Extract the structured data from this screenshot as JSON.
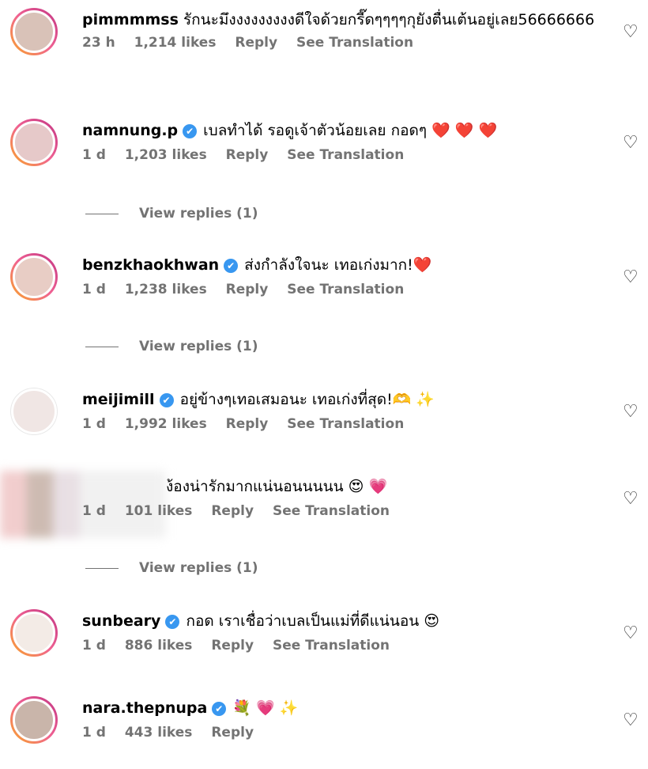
{
  "comments": [
    {
      "username": "pimmmmss",
      "verified": false,
      "text": "รักนะมึงงงงงงงงงดีใจด้วยกรี๊ดๆๆๆๆกุยังตื่นเต้นอยู่เลย56666666",
      "time": "23 h",
      "likes": "1,214 likes",
      "reply": "Reply",
      "translate": "See Translation",
      "view_replies": ""
    },
    {
      "username": "namnung.p",
      "verified": true,
      "text": "เบลทำได้ รอดูเจ้าตัวน้อยเลย กอดๆ ❤️ ❤️ ❤️",
      "time": "1 d",
      "likes": "1,203 likes",
      "reply": "Reply",
      "translate": "See Translation",
      "view_replies": "View replies (1)"
    },
    {
      "username": "benzkhaokhwan",
      "verified": true,
      "text": "ส่งกำลังใจนะ เทอเก่งมาก!❤️",
      "time": "1 d",
      "likes": "1,238 likes",
      "reply": "Reply",
      "translate": "See Translation",
      "view_replies": "View replies (1)"
    },
    {
      "username": "meijimill",
      "verified": true,
      "text": "อยู่ข้างๆเทอเสมอนะ เทอเก่งที่สุด!🫶 ✨",
      "time": "1 d",
      "likes": "1,992 likes",
      "reply": "Reply",
      "translate": "See Translation",
      "view_replies": ""
    },
    {
      "username": "",
      "verified": false,
      "text": "ง้องน่ารักมากแน่นอนนนนน 😍 💗",
      "time": "1 d",
      "likes": "101 likes",
      "reply": "Reply",
      "translate": "See Translation",
      "view_replies": "View replies (1)"
    },
    {
      "username": "sunbeary",
      "verified": true,
      "text": "กอด เราเชื่อว่าเบลเป็นแม่ที่ดีแน่นอน 😍",
      "time": "1 d",
      "likes": "886 likes",
      "reply": "Reply",
      "translate": "See Translation",
      "view_replies": ""
    },
    {
      "username": "nara.thepnupa",
      "verified": true,
      "text": "💐 💗 ✨",
      "time": "1 d",
      "likes": "443 likes",
      "reply": "Reply",
      "translate": "",
      "view_replies": ""
    }
  ],
  "icons": {
    "heart": "heart-outline-icon",
    "verified": "verified-badge-icon"
  }
}
